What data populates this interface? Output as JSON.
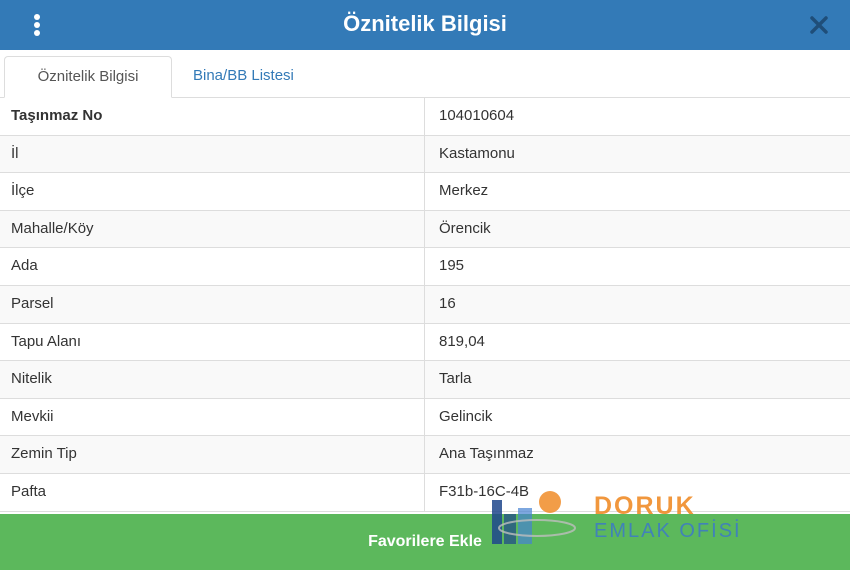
{
  "header": {
    "title": "Öznitelik Bilgisi",
    "menu_icon": "vertical-ellipsis-icon",
    "close_icon": "close-icon"
  },
  "tabs": [
    {
      "label": "Öznitelik Bilgisi",
      "active": true
    },
    {
      "label": "Bina/BB Listesi",
      "active": false
    }
  ],
  "attributes": [
    {
      "key": "Taşınmaz No",
      "value": "104010604"
    },
    {
      "key": "İl",
      "value": "Kastamonu"
    },
    {
      "key": "İlçe",
      "value": "Merkez"
    },
    {
      "key": "Mahalle/Köy",
      "value": "Örencik"
    },
    {
      "key": "Ada",
      "value": "195"
    },
    {
      "key": "Parsel",
      "value": "16"
    },
    {
      "key": "Tapu Alanı",
      "value": "819,04"
    },
    {
      "key": "Nitelik",
      "value": "Tarla"
    },
    {
      "key": "Mevkii",
      "value": "Gelincik"
    },
    {
      "key": "Zemin Tip",
      "value": "Ana Taşınmaz"
    },
    {
      "key": "Pafta",
      "value": "F31b-16C-4B"
    }
  ],
  "footer": {
    "button_label": "Favorilere Ekle"
  },
  "watermark": {
    "line1": "DORUK",
    "line2": "EMLAK OFİSİ"
  },
  "colors": {
    "header": "#337ab7",
    "footer": "#5cb85c",
    "tab_link": "#337ab7"
  }
}
